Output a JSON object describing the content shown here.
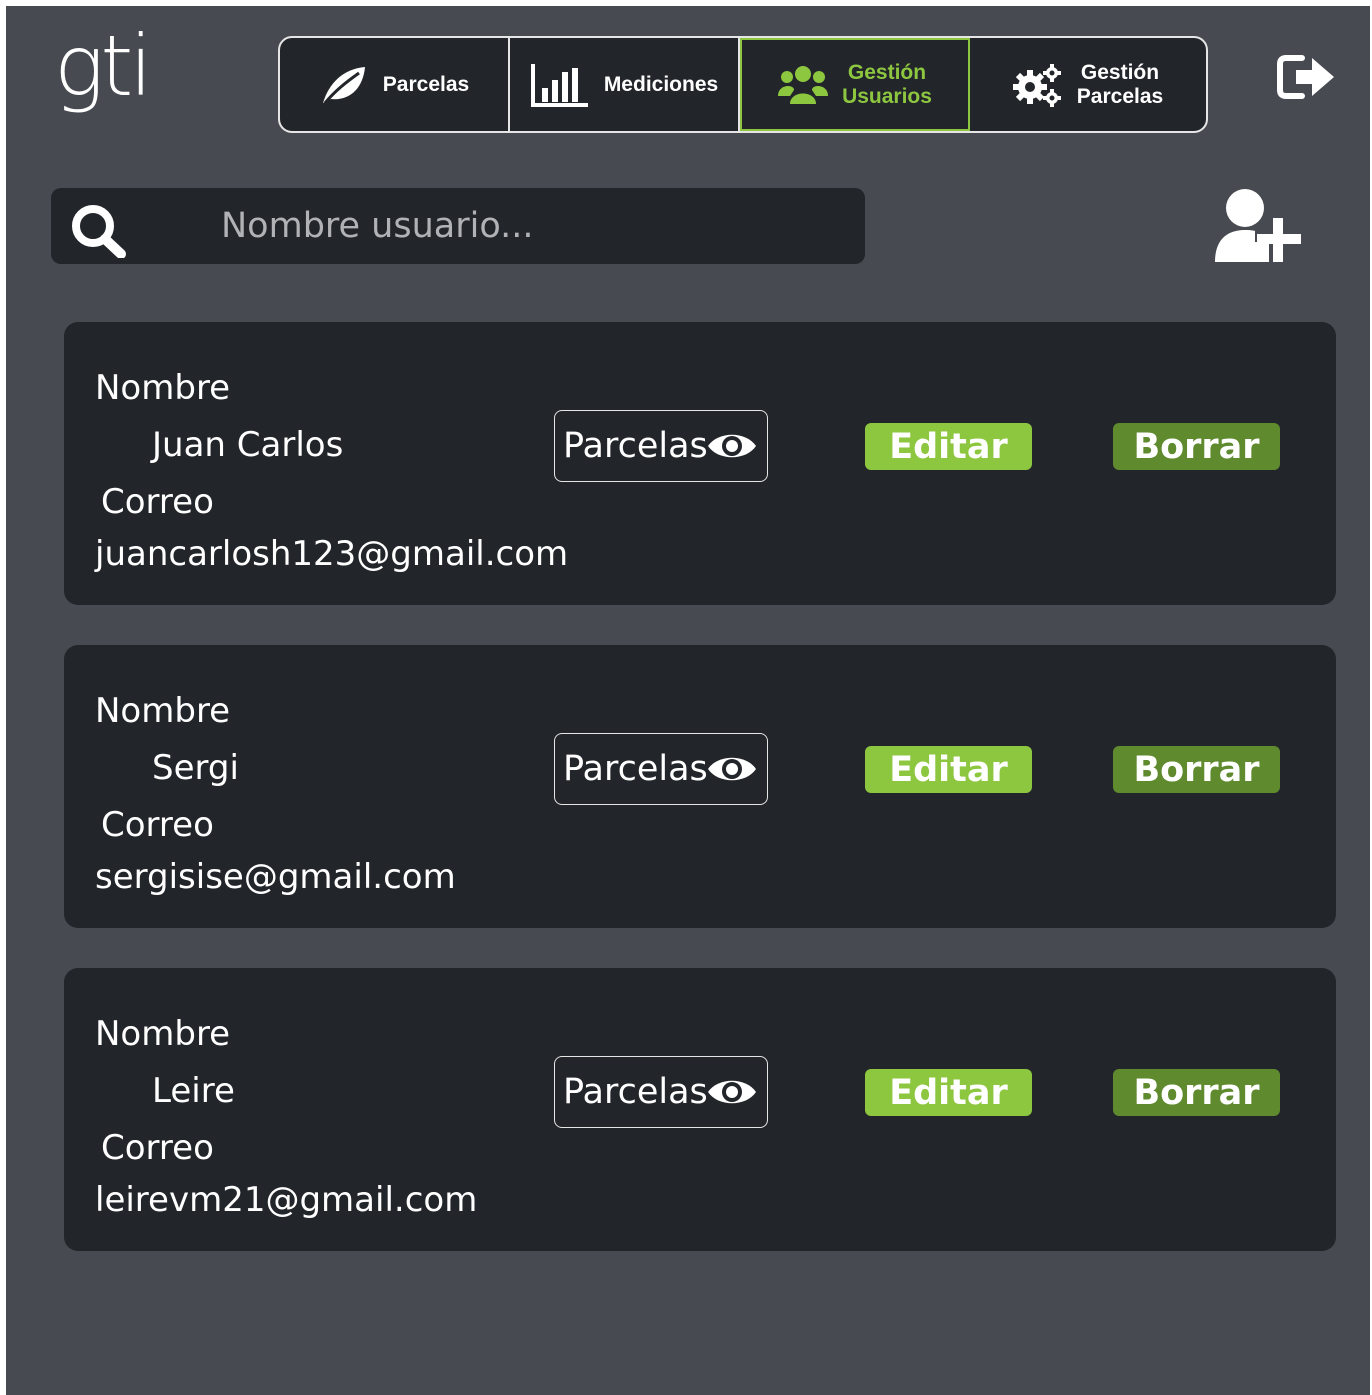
{
  "app": {
    "logo": "gti"
  },
  "nav": {
    "items": [
      {
        "label": "Parcelas",
        "icon": "leaf-icon",
        "active": false
      },
      {
        "label": "Mediciones",
        "icon": "bar-chart-icon",
        "active": false
      },
      {
        "label_line1": "Gestión",
        "label_line2": "Usuarios",
        "icon": "users-icon",
        "active": true
      },
      {
        "label_line1": "Gestión",
        "label_line2": "Parcelas",
        "icon": "gears-icon",
        "active": false
      }
    ]
  },
  "colors": {
    "accent": "#8dc63f",
    "delete": "#5f8a2e",
    "background": "#474a50",
    "panel": "#22252a"
  },
  "search": {
    "placeholder": "Nombre usuario...",
    "value": ""
  },
  "users": [
    {
      "nombre_label": "Nombre",
      "nombre": "Juan Carlos",
      "correo_label": "Correo",
      "correo": "juancarlosh123@gmail.com",
      "parcelas_label": "Parcelas",
      "editar_label": "Editar",
      "borrar_label": "Borrar"
    },
    {
      "nombre_label": "Nombre",
      "nombre": "Sergi",
      "correo_label": "Correo",
      "correo": "sergisise@gmail.com",
      "parcelas_label": "Parcelas",
      "editar_label": "Editar",
      "borrar_label": "Borrar"
    },
    {
      "nombre_label": "Nombre",
      "nombre": "Leire",
      "correo_label": "Correo",
      "correo": "leirevm21@gmail.com",
      "parcelas_label": "Parcelas",
      "editar_label": "Editar",
      "borrar_label": "Borrar"
    }
  ]
}
